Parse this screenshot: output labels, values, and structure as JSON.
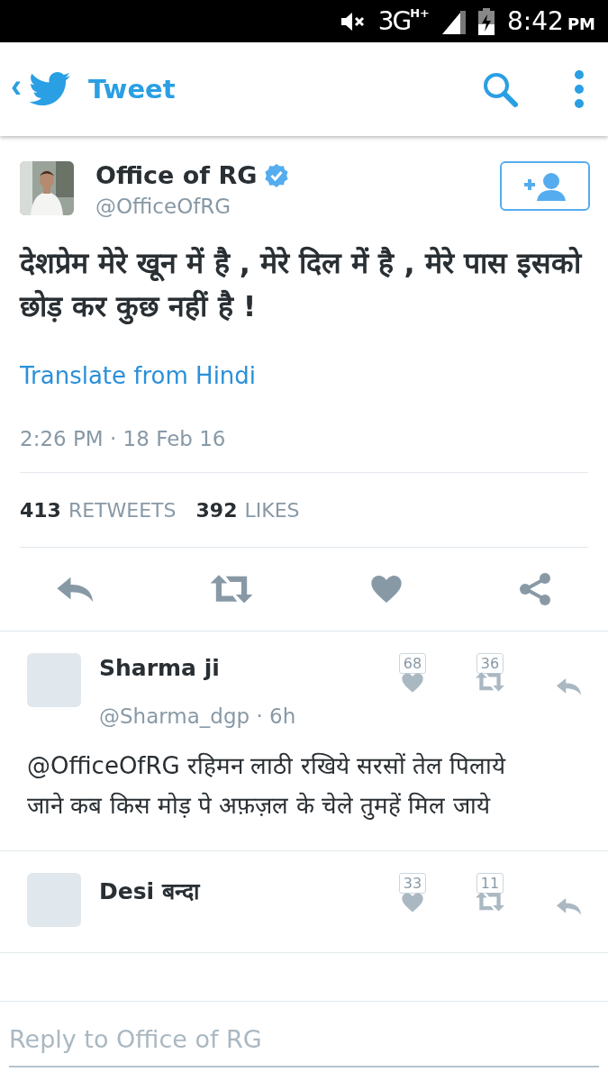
{
  "status_bar": {
    "network": "3G",
    "network_sup": "H+",
    "time": "8:42",
    "ampm": "PM"
  },
  "header": {
    "back": "‹",
    "title": "Tweet"
  },
  "tweet": {
    "author": "Office of RG",
    "verified": true,
    "handle": "@OfficeOfRG",
    "text": "देशप्रेम मेरे खून में है , मेरे दिल में है , मेरे पास इसको छोड़ कर कुछ नहीं है !",
    "translate": "Translate from Hindi",
    "timestamp": "2:26 PM · 18 Feb 16",
    "retweets_count": "413",
    "retweets_label": "RETWEETS",
    "likes_count": "392",
    "likes_label": "LIKES"
  },
  "replies": [
    {
      "name": "Sharma ji",
      "handle": "@Sharma_dgp · 6h",
      "likes": "68",
      "retweets": "36",
      "text": "@OfficeOfRG रहिमन लाठी रखिये सरसों तेल पिलाये\nजाने कब किस मोड़ पे अफ़ज़ल के चेले तुमहें मिल जाये"
    },
    {
      "name": "Desi बन्दा",
      "likes": "33",
      "retweets": "11"
    }
  ],
  "reply_field": {
    "placeholder": "Reply to Office of RG"
  }
}
